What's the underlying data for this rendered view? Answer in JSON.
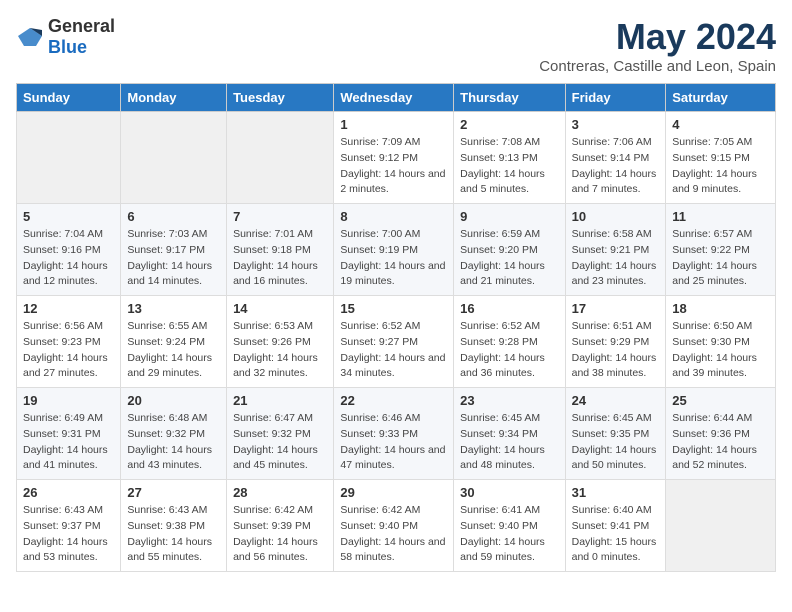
{
  "header": {
    "logo_general": "General",
    "logo_blue": "Blue",
    "title": "May 2024",
    "subtitle": "Contreras, Castille and Leon, Spain"
  },
  "columns": [
    "Sunday",
    "Monday",
    "Tuesday",
    "Wednesday",
    "Thursday",
    "Friday",
    "Saturday"
  ],
  "weeks": [
    [
      {
        "day": "",
        "sunrise": "",
        "sunset": "",
        "daylight": ""
      },
      {
        "day": "",
        "sunrise": "",
        "sunset": "",
        "daylight": ""
      },
      {
        "day": "",
        "sunrise": "",
        "sunset": "",
        "daylight": ""
      },
      {
        "day": "1",
        "sunrise": "Sunrise: 7:09 AM",
        "sunset": "Sunset: 9:12 PM",
        "daylight": "Daylight: 14 hours and 2 minutes."
      },
      {
        "day": "2",
        "sunrise": "Sunrise: 7:08 AM",
        "sunset": "Sunset: 9:13 PM",
        "daylight": "Daylight: 14 hours and 5 minutes."
      },
      {
        "day": "3",
        "sunrise": "Sunrise: 7:06 AM",
        "sunset": "Sunset: 9:14 PM",
        "daylight": "Daylight: 14 hours and 7 minutes."
      },
      {
        "day": "4",
        "sunrise": "Sunrise: 7:05 AM",
        "sunset": "Sunset: 9:15 PM",
        "daylight": "Daylight: 14 hours and 9 minutes."
      }
    ],
    [
      {
        "day": "5",
        "sunrise": "Sunrise: 7:04 AM",
        "sunset": "Sunset: 9:16 PM",
        "daylight": "Daylight: 14 hours and 12 minutes."
      },
      {
        "day": "6",
        "sunrise": "Sunrise: 7:03 AM",
        "sunset": "Sunset: 9:17 PM",
        "daylight": "Daylight: 14 hours and 14 minutes."
      },
      {
        "day": "7",
        "sunrise": "Sunrise: 7:01 AM",
        "sunset": "Sunset: 9:18 PM",
        "daylight": "Daylight: 14 hours and 16 minutes."
      },
      {
        "day": "8",
        "sunrise": "Sunrise: 7:00 AM",
        "sunset": "Sunset: 9:19 PM",
        "daylight": "Daylight: 14 hours and 19 minutes."
      },
      {
        "day": "9",
        "sunrise": "Sunrise: 6:59 AM",
        "sunset": "Sunset: 9:20 PM",
        "daylight": "Daylight: 14 hours and 21 minutes."
      },
      {
        "day": "10",
        "sunrise": "Sunrise: 6:58 AM",
        "sunset": "Sunset: 9:21 PM",
        "daylight": "Daylight: 14 hours and 23 minutes."
      },
      {
        "day": "11",
        "sunrise": "Sunrise: 6:57 AM",
        "sunset": "Sunset: 9:22 PM",
        "daylight": "Daylight: 14 hours and 25 minutes."
      }
    ],
    [
      {
        "day": "12",
        "sunrise": "Sunrise: 6:56 AM",
        "sunset": "Sunset: 9:23 PM",
        "daylight": "Daylight: 14 hours and 27 minutes."
      },
      {
        "day": "13",
        "sunrise": "Sunrise: 6:55 AM",
        "sunset": "Sunset: 9:24 PM",
        "daylight": "Daylight: 14 hours and 29 minutes."
      },
      {
        "day": "14",
        "sunrise": "Sunrise: 6:53 AM",
        "sunset": "Sunset: 9:26 PM",
        "daylight": "Daylight: 14 hours and 32 minutes."
      },
      {
        "day": "15",
        "sunrise": "Sunrise: 6:52 AM",
        "sunset": "Sunset: 9:27 PM",
        "daylight": "Daylight: 14 hours and 34 minutes."
      },
      {
        "day": "16",
        "sunrise": "Sunrise: 6:52 AM",
        "sunset": "Sunset: 9:28 PM",
        "daylight": "Daylight: 14 hours and 36 minutes."
      },
      {
        "day": "17",
        "sunrise": "Sunrise: 6:51 AM",
        "sunset": "Sunset: 9:29 PM",
        "daylight": "Daylight: 14 hours and 38 minutes."
      },
      {
        "day": "18",
        "sunrise": "Sunrise: 6:50 AM",
        "sunset": "Sunset: 9:30 PM",
        "daylight": "Daylight: 14 hours and 39 minutes."
      }
    ],
    [
      {
        "day": "19",
        "sunrise": "Sunrise: 6:49 AM",
        "sunset": "Sunset: 9:31 PM",
        "daylight": "Daylight: 14 hours and 41 minutes."
      },
      {
        "day": "20",
        "sunrise": "Sunrise: 6:48 AM",
        "sunset": "Sunset: 9:32 PM",
        "daylight": "Daylight: 14 hours and 43 minutes."
      },
      {
        "day": "21",
        "sunrise": "Sunrise: 6:47 AM",
        "sunset": "Sunset: 9:32 PM",
        "daylight": "Daylight: 14 hours and 45 minutes."
      },
      {
        "day": "22",
        "sunrise": "Sunrise: 6:46 AM",
        "sunset": "Sunset: 9:33 PM",
        "daylight": "Daylight: 14 hours and 47 minutes."
      },
      {
        "day": "23",
        "sunrise": "Sunrise: 6:45 AM",
        "sunset": "Sunset: 9:34 PM",
        "daylight": "Daylight: 14 hours and 48 minutes."
      },
      {
        "day": "24",
        "sunrise": "Sunrise: 6:45 AM",
        "sunset": "Sunset: 9:35 PM",
        "daylight": "Daylight: 14 hours and 50 minutes."
      },
      {
        "day": "25",
        "sunrise": "Sunrise: 6:44 AM",
        "sunset": "Sunset: 9:36 PM",
        "daylight": "Daylight: 14 hours and 52 minutes."
      }
    ],
    [
      {
        "day": "26",
        "sunrise": "Sunrise: 6:43 AM",
        "sunset": "Sunset: 9:37 PM",
        "daylight": "Daylight: 14 hours and 53 minutes."
      },
      {
        "day": "27",
        "sunrise": "Sunrise: 6:43 AM",
        "sunset": "Sunset: 9:38 PM",
        "daylight": "Daylight: 14 hours and 55 minutes."
      },
      {
        "day": "28",
        "sunrise": "Sunrise: 6:42 AM",
        "sunset": "Sunset: 9:39 PM",
        "daylight": "Daylight: 14 hours and 56 minutes."
      },
      {
        "day": "29",
        "sunrise": "Sunrise: 6:42 AM",
        "sunset": "Sunset: 9:40 PM",
        "daylight": "Daylight: 14 hours and 58 minutes."
      },
      {
        "day": "30",
        "sunrise": "Sunrise: 6:41 AM",
        "sunset": "Sunset: 9:40 PM",
        "daylight": "Daylight: 14 hours and 59 minutes."
      },
      {
        "day": "31",
        "sunrise": "Sunrise: 6:40 AM",
        "sunset": "Sunset: 9:41 PM",
        "daylight": "Daylight: 15 hours and 0 minutes."
      },
      {
        "day": "",
        "sunrise": "",
        "sunset": "",
        "daylight": ""
      }
    ]
  ]
}
